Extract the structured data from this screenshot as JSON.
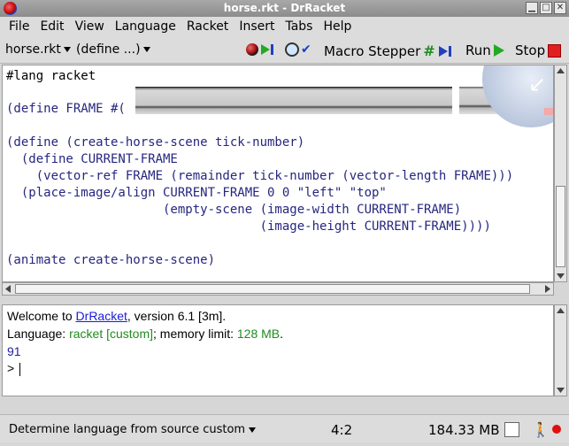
{
  "window": {
    "title": "horse.rkt - DrRacket"
  },
  "menu": [
    "File",
    "Edit",
    "View",
    "Language",
    "Racket",
    "Insert",
    "Tabs",
    "Help"
  ],
  "toolbar": {
    "file_selector": "horse.rkt",
    "define_selector": "(define ...)",
    "macro_stepper": "Macro Stepper",
    "run": "Run",
    "stop": "Stop"
  },
  "editor": {
    "lines": [
      "#lang racket",
      "(define FRAME #(",
      "(define (create-horse-scene tick-number)",
      "  (define CURRENT-FRAME",
      "    (vector-ref FRAME (remainder tick-number (vector-length FRAME)))",
      "  (place-image/align CURRENT-FRAME 0 0 \"left\" \"top\"",
      "                     (empty-scene (image-width CURRENT-FRAME)",
      "                                  (image-height CURRENT-FRAME))))",
      "(animate create-horse-scene)"
    ]
  },
  "repl": {
    "welcome_prefix": "Welcome to ",
    "app_link": "DrRacket",
    "welcome_suffix": ", version 6.1 [3m].",
    "lang_prefix": "Language: ",
    "lang_value": "racket [custom]",
    "mem_prefix": "; memory limit: ",
    "mem_value": "128 MB",
    "mem_suffix": ".",
    "output": "91",
    "prompt": ">"
  },
  "status": {
    "language": "Determine language from source custom",
    "position": "4:2",
    "memory": "184.33 MB"
  },
  "colors": {
    "keyword": "#262680",
    "link": "#1a1adc",
    "green": "#1f8c1f",
    "stop": "#e02020",
    "run": "#22aa22"
  }
}
